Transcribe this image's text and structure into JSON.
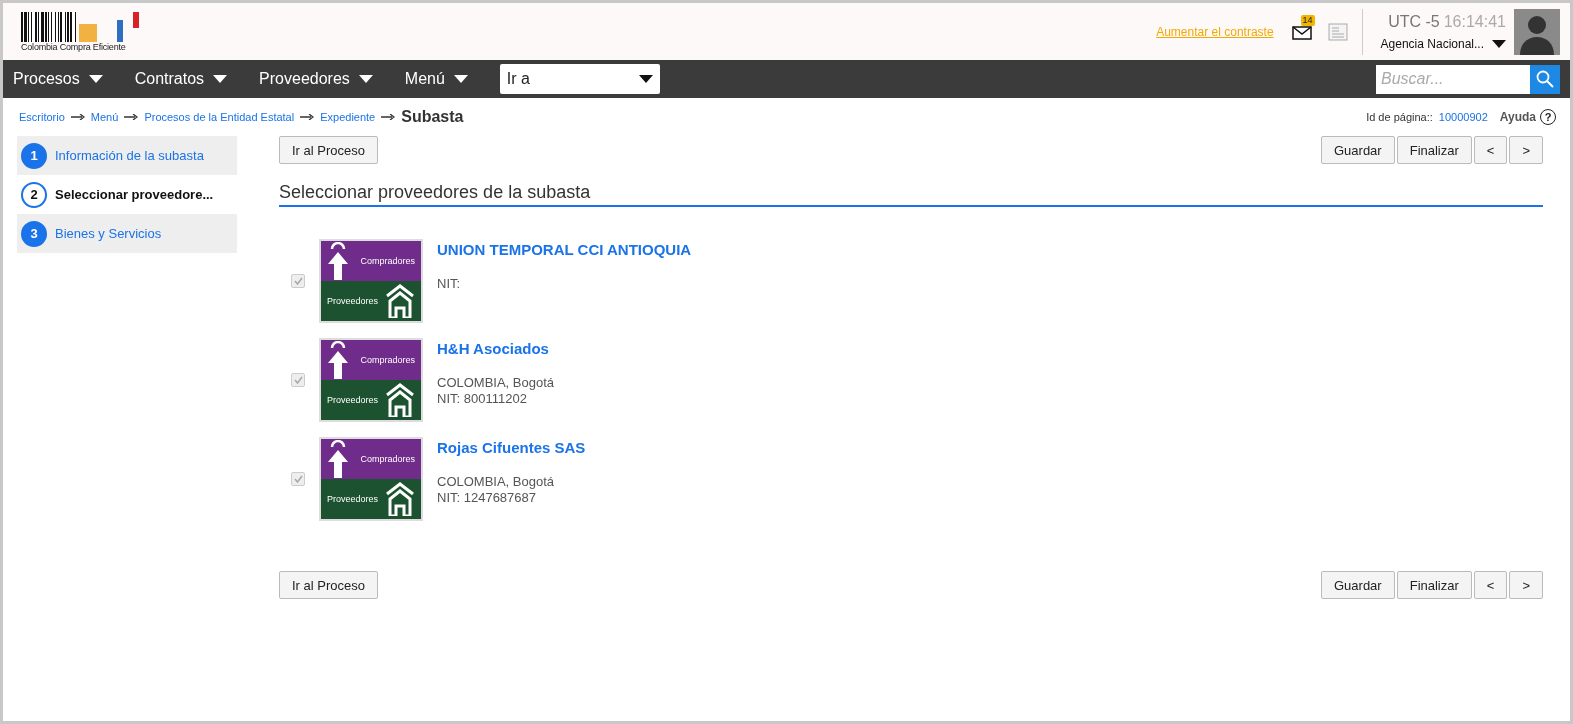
{
  "header": {
    "logo_text": "Colombia Compra Eficiente",
    "contrast_link": "Aumentar el contraste",
    "mail_count": "14",
    "timezone": "UTC -5",
    "time": "16:14:41",
    "account": "Agencia Nacional..."
  },
  "nav": {
    "menus": [
      "Procesos",
      "Contratos",
      "Proveedores",
      "Menú"
    ],
    "goto": "Ir a",
    "search_placeholder": "Buscar..."
  },
  "breadcrumb": {
    "items": [
      "Escritorio",
      "Menú",
      "Procesos de la Entidad Estatal",
      "Expediente"
    ],
    "current": "Subasta",
    "page_id_label": "Id de página::",
    "page_id": "10000902",
    "help": "Ayuda",
    "help_icon": "?"
  },
  "steps": [
    {
      "number": "1",
      "label": "Información de la subasta",
      "selected": false
    },
    {
      "number": "2",
      "label": "Seleccionar proveedore...",
      "selected": true
    },
    {
      "number": "3",
      "label": "Bienes y Servicios",
      "selected": false
    }
  ],
  "toolbars": [
    {
      "back": "Ir al Proceso",
      "save": "Guardar",
      "finish": "Finalizar",
      "prev": "<",
      "next": ">"
    },
    {
      "back": "Ir al Proceso",
      "save": "Guardar",
      "finish": "Finalizar",
      "prev": "<",
      "next": ">"
    }
  ],
  "section_title": "Seleccionar proveedores de la subasta",
  "suppliers": [
    {
      "name": "UNION TEMPORAL CCI ANTIOQUIA",
      "lines": [
        "NIT:"
      ],
      "checked": true,
      "logo_top": "Compradores",
      "logo_bottom": "Proveedores"
    },
    {
      "name": "H&H Asociados",
      "lines": [
        "COLOMBIA, Bogotá",
        "NIT: 800111202"
      ],
      "checked": true,
      "logo_top": "Compradores",
      "logo_bottom": "Proveedores"
    },
    {
      "name": "Rojas Cifuentes SAS",
      "lines": [
        "COLOMBIA, Bogotá",
        "NIT: 1247687687"
      ],
      "checked": true,
      "logo_top": "Compradores",
      "logo_bottom": "Proveedores"
    }
  ]
}
